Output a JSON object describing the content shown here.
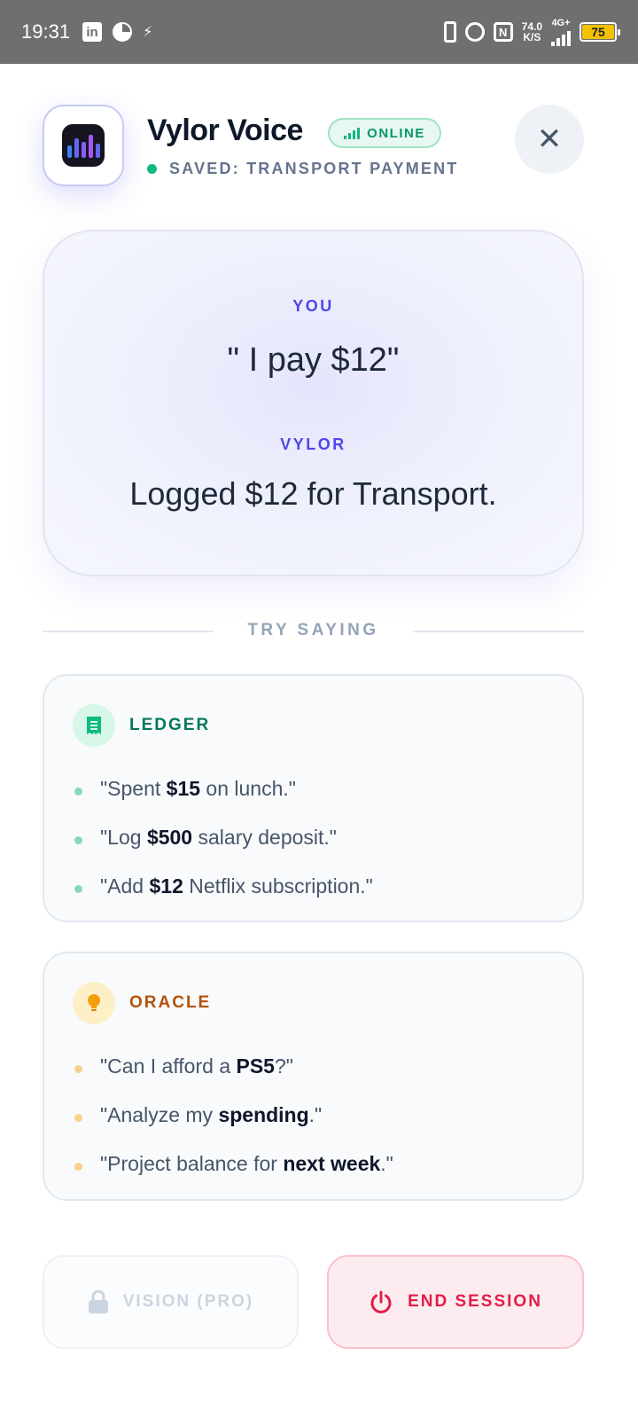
{
  "status_bar": {
    "time": "19:31",
    "linkedin": "in",
    "net_speed_value": "74.0",
    "net_speed_unit": "K/S",
    "network_type": "4G+",
    "battery_level": "75",
    "icons": [
      "linkedin-icon",
      "pie-icon",
      "activity-icon",
      "vibrate-icon",
      "alarm-icon",
      "nfc-icon",
      "signal-icon",
      "battery-icon"
    ]
  },
  "header": {
    "app_name": "Vylor Voice",
    "online_label": "ONLINE",
    "saved_status": "SAVED: TRANSPORT PAYMENT",
    "close_glyph": "✕"
  },
  "conversation": {
    "you_label": "YOU",
    "you_text": "\" I pay $12\"",
    "vylor_label": "VYLOR",
    "vylor_text": "Logged $12 for Transport."
  },
  "try_saying": "TRY SAYING",
  "ledger": {
    "title": "LEDGER",
    "items": [
      {
        "pre": "\"Spent ",
        "bold": "$15",
        "post": " on lunch.\""
      },
      {
        "pre": "\"Log ",
        "bold": "$500",
        "post": " salary deposit.\""
      },
      {
        "pre": "\"Add ",
        "bold": "$12",
        "post": " Netflix subscription.\""
      }
    ]
  },
  "oracle": {
    "title": "ORACLE",
    "items": [
      {
        "pre": "\"Can I afford a ",
        "bold": "PS5",
        "post": "?\""
      },
      {
        "pre": "\"Analyze my ",
        "bold": "spending",
        "post": ".\""
      },
      {
        "pre": "\"Project balance for ",
        "bold": "next week",
        "post": ".\""
      }
    ]
  },
  "buttons": {
    "vision_label": "VISION (PRO)",
    "end_label": "END SESSION"
  },
  "colors": {
    "accent": "#4f46e5",
    "online_green": "#10b981",
    "ledger_green": "#047857",
    "oracle_amber": "#b45309",
    "danger": "#e11d48"
  }
}
